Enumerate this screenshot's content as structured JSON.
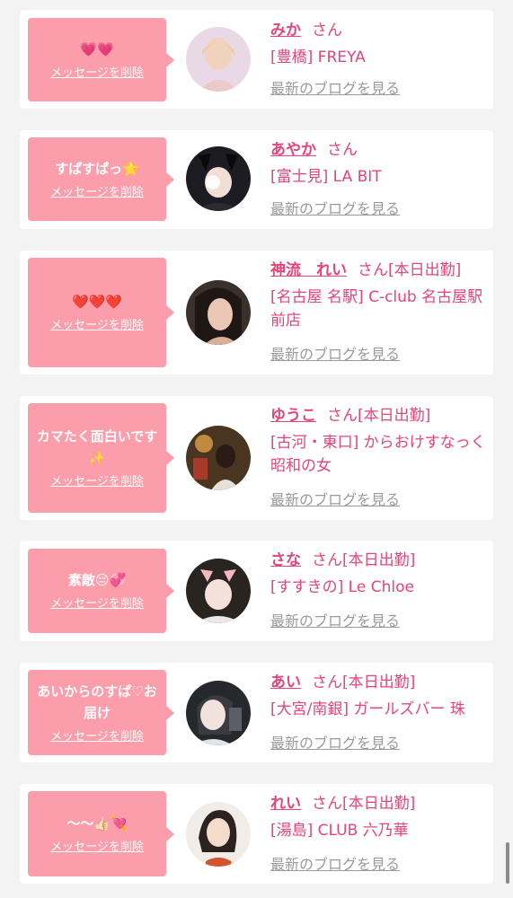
{
  "labels": {
    "delete": "メッセージを削除",
    "blog": "最新のブログを見る",
    "honorific": "さん"
  },
  "colors": {
    "bubble": "#fb9dab",
    "accent": "#e5457a",
    "link_gray": "#9a9a9a",
    "page_bg": "#f3f3f3"
  },
  "items": [
    {
      "message": "💗💗",
      "name": "みか",
      "status": "",
      "shop": "[豊橋] FREYA",
      "avatar_icon": "profile-photo"
    },
    {
      "message": "すぱすぱっ🌟",
      "name": "あやか",
      "status": "",
      "shop": "[富士見] LA BIT",
      "avatar_icon": "profile-photo"
    },
    {
      "message": "❤️❤️❤️",
      "name": "神流　れい",
      "status": "[本日出勤]",
      "shop": "[名古屋 名駅] C-club 名古屋駅前店",
      "avatar_icon": "profile-photo"
    },
    {
      "message": "カマたく面白いです✨",
      "name": "ゆうこ",
      "status": "[本日出勤]",
      "shop": "[古河・東口] からおけすなっく 昭和の女",
      "avatar_icon": "profile-photo"
    },
    {
      "message": "素敵😔💞",
      "name": "さな",
      "status": "[本日出勤]",
      "shop": "[すすきの] Le Chloe",
      "avatar_icon": "profile-photo"
    },
    {
      "message": "あいからのすぱ♡お届け",
      "name": "あい",
      "status": "[本日出勤]",
      "shop": "[大宮/南銀] ガールズバー 珠",
      "avatar_icon": "profile-photo"
    },
    {
      "message": "〜〜👍🏻💘",
      "name": "れい",
      "status": "[本日出勤]",
      "shop": "[湯島] CLUB 六乃華",
      "avatar_icon": "profile-photo"
    }
  ]
}
